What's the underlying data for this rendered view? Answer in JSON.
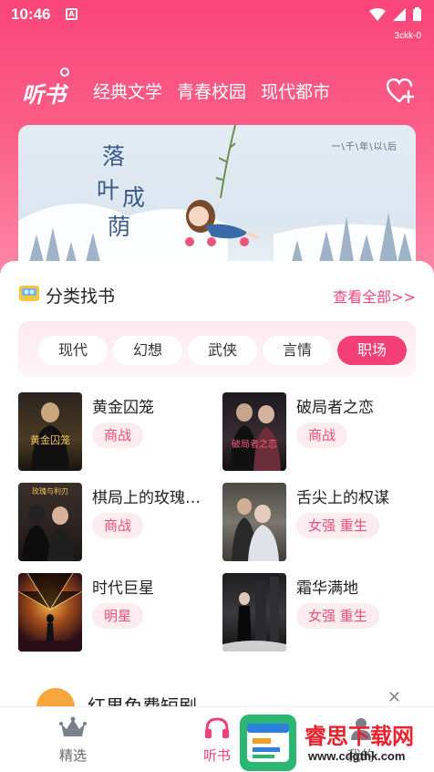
{
  "status": {
    "time": "10:46",
    "notif_letter": "A",
    "device_id": "3ckk-0"
  },
  "header": {
    "logo": "听书",
    "tabs": [
      "经典文学",
      "青春校园",
      "现代都市"
    ],
    "fav_icon": "heart-plus-icon"
  },
  "banner": {
    "title_chars": [
      "落",
      "叶",
      "成",
      "荫"
    ],
    "subtitle": "一\\千\\年\\以\\后"
  },
  "category": {
    "title": "分类找书",
    "more": "查看全部>>",
    "chips": [
      "现代",
      "幻想",
      "武侠",
      "言情",
      "职场"
    ],
    "active_chip": "职场"
  },
  "books": [
    {
      "title": "黄金囚笼",
      "tag": "商战",
      "cover_text": "黄金囚笼"
    },
    {
      "title": "破局者之恋",
      "tag": "商战",
      "cover_text": "破局者之恋"
    },
    {
      "title": "棋局上的玫瑰…",
      "tag": "商战",
      "cover_text": "玫瑰与利刃"
    },
    {
      "title": "舌尖上的权谋",
      "tag": "女强 重生",
      "cover_text": ""
    },
    {
      "title": "时代巨星",
      "tag": "明星",
      "cover_text": ""
    },
    {
      "title": "霜华满地",
      "tag": "女强 重生",
      "cover_text": ""
    }
  ],
  "drama": {
    "title": "红果免费短剧"
  },
  "bottom_nav": {
    "items": [
      "精选",
      "听书",
      "我的"
    ],
    "active": "听书"
  },
  "watermark": {
    "name": "睿思下载网",
    "url": "www.cdgthk.com"
  },
  "colors": {
    "accent": "#f23f76",
    "tag_bg": "#fdecef",
    "header_top": "#f9457a"
  }
}
